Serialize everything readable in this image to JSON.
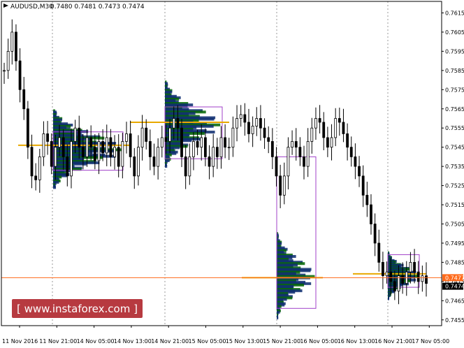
{
  "header": {
    "symbol": "AUDUSD,M30",
    "values": "0.7480 0.7481 0.7473 0.7474"
  },
  "watermark": {
    "text": "[ www.instaforex.com ]"
  },
  "colors": {
    "candle": "#000000",
    "grid": "#9a9a9a",
    "current_line": "#ff6a1a",
    "profile_green": "#006400",
    "profile_blue": "#0a2a6e",
    "value_area_box": "#a040c8",
    "poc_line": "#e8a800",
    "current_tag": "#ff6a1a",
    "last_tag": "#000000",
    "watermark_bg": "#b73a40"
  },
  "chart_data": {
    "type": "candlestick",
    "y_ticks": [
      "0.7615",
      "0.7605",
      "0.7595",
      "0.7585",
      "0.7575",
      "0.7565",
      "0.7555",
      "0.7545",
      "0.7535",
      "0.7525",
      "0.7515",
      "0.7505",
      "0.7495",
      "0.7485",
      "0.7475",
      "0.7465",
      "0.7455"
    ],
    "ylim": [
      0.7452,
      0.7621
    ],
    "x_ticks": [
      "11 Nov 2016",
      "11 Nov 21:00",
      "14 Nov 05:00",
      "14 Nov 13:00",
      "14 Nov 21:00",
      "15 Nov 05:00",
      "15 Nov 13:00",
      "15 Nov 21:00",
      "16 Nov 05:00",
      "16 Nov 13:00",
      "16 Nov 21:00",
      "17 Nov 05:00"
    ],
    "current_price": "0.7477",
    "last_price": "0.7474",
    "current_price_value": 0.7477,
    "last_price_value": 0.7474,
    "closes": [
      0.7585,
      0.7595,
      0.7605,
      0.759,
      0.7575,
      0.7565,
      0.7545,
      0.753,
      0.7528,
      0.754,
      0.7552,
      0.7548,
      0.7535,
      0.7545,
      0.755,
      0.754,
      0.753,
      0.7548,
      0.7555,
      0.7545,
      0.754,
      0.755,
      0.7545,
      0.7538,
      0.7548,
      0.7542,
      0.755,
      0.754,
      0.7545,
      0.7535,
      0.7548,
      0.7552,
      0.754,
      0.753,
      0.7545,
      0.7555,
      0.7548,
      0.754,
      0.7535,
      0.7545,
      0.755,
      0.7548,
      0.7555,
      0.756,
      0.7555,
      0.754,
      0.753,
      0.754,
      0.7548,
      0.7545,
      0.755,
      0.754,
      0.7535,
      0.7545,
      0.754,
      0.755,
      0.7545,
      0.7545,
      0.7555,
      0.756,
      0.7562,
      0.7558,
      0.7552,
      0.7556,
      0.756,
      0.7555,
      0.755,
      0.7548,
      0.754,
      0.753,
      0.752,
      0.753,
      0.7545,
      0.7548,
      0.7545,
      0.754,
      0.7535,
      0.7548,
      0.7555,
      0.756,
      0.7558,
      0.755,
      0.7545,
      0.755,
      0.756,
      0.7558,
      0.7552,
      0.7545,
      0.754,
      0.7535,
      0.753,
      0.752,
      0.7515,
      0.7505,
      0.7495,
      0.7485,
      0.7478,
      0.748,
      0.7475,
      0.747,
      0.7478,
      0.7474,
      0.748,
      0.7485,
      0.748,
      0.7475,
      0.7478,
      0.7474
    ]
  }
}
